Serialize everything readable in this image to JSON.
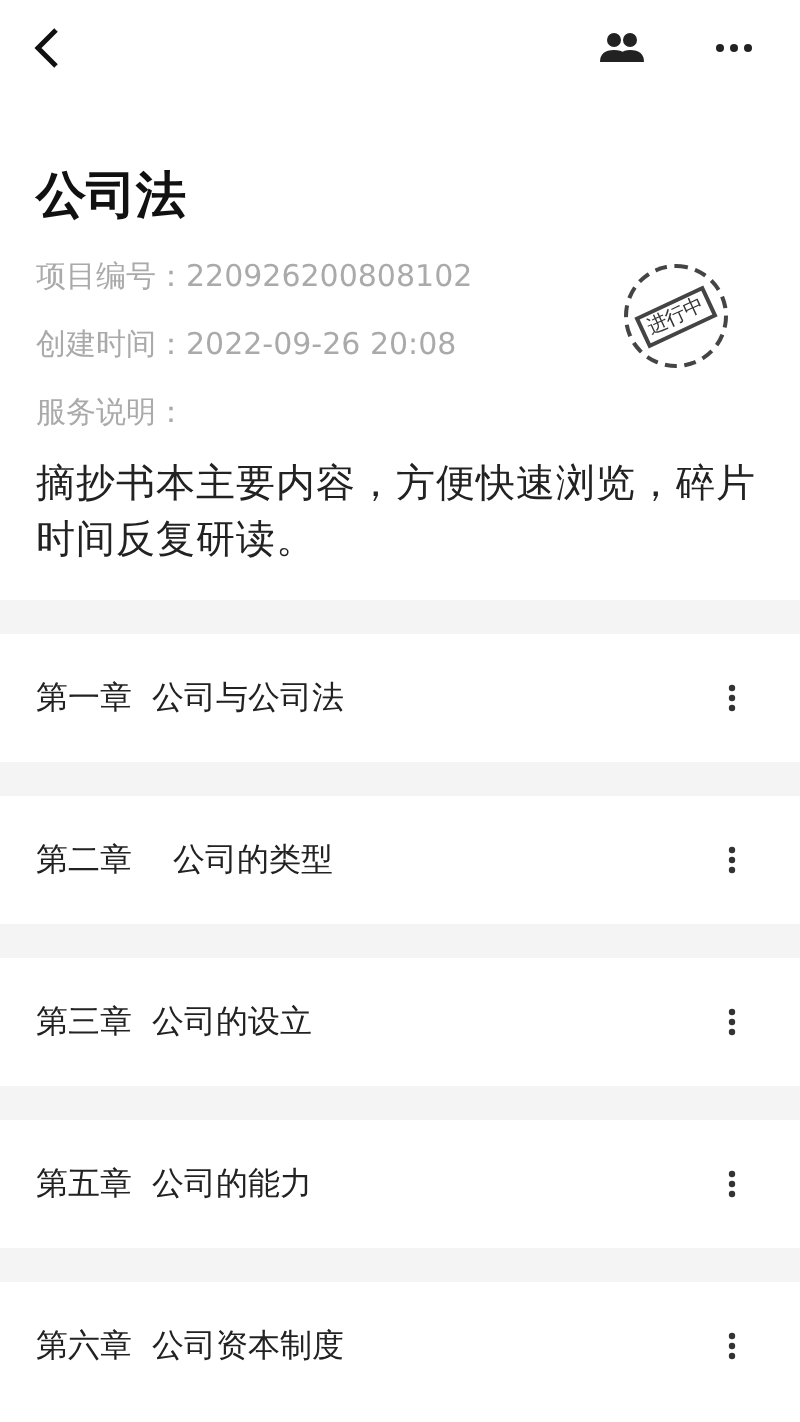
{
  "title": "公司法",
  "meta": [
    {
      "label": "项目编号：",
      "value": "220926200808102"
    },
    {
      "label": "创建时间：",
      "value": "2022-09-26 20:08"
    },
    {
      "label": "服务说明："
    }
  ],
  "stamp": "进行中",
  "description": "摘抄书本主要内容，方便快速浏览，碎片时间反复研读。",
  "chapters": [
    {
      "title": "第一章  公司与公司法"
    },
    {
      "title": "第二章    公司的类型"
    },
    {
      "title": "第三章  公司的设立"
    },
    {
      "title": "第五章  公司的能力"
    },
    {
      "title": "第六章  公司资本制度"
    }
  ]
}
